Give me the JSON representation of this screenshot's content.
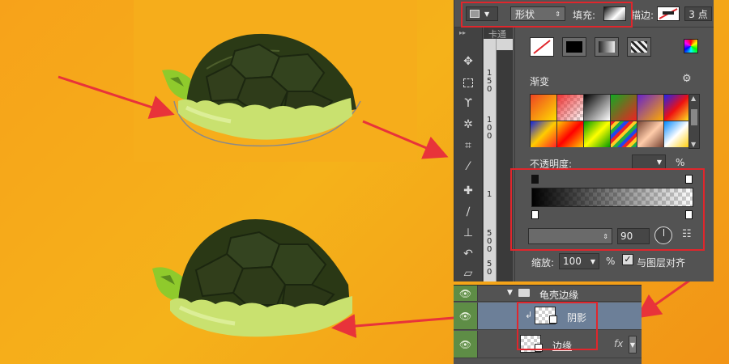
{
  "options_bar": {
    "mode_label": "形状",
    "fill_label": "填充:",
    "stroke_label": "描边:",
    "stroke_width": "3 点"
  },
  "doc_tab": {
    "label": "卡通"
  },
  "ruler": {
    "marks": [
      "1",
      "5",
      "0",
      "1",
      "0",
      "0",
      "1",
      "5",
      "0",
      "0",
      "5",
      "0"
    ]
  },
  "gradient_panel": {
    "title": "渐变",
    "opacity_label": "不透明度:",
    "opacity_unit": "%",
    "angle_value": "90",
    "scale_label": "缩放:",
    "scale_value": "100",
    "scale_unit": "%",
    "align_label": "与图层对齐"
  },
  "layers": {
    "group_name": "龟壳边缘",
    "shadow_layer": "阴影",
    "edge_layer": "边缘",
    "fx_label": "fx"
  },
  "colors": {
    "panel": "#535353",
    "highlight_red": "#e0262c",
    "canvas_orange": "#f7a21a",
    "layer_eye_green": "#5e8d46"
  }
}
